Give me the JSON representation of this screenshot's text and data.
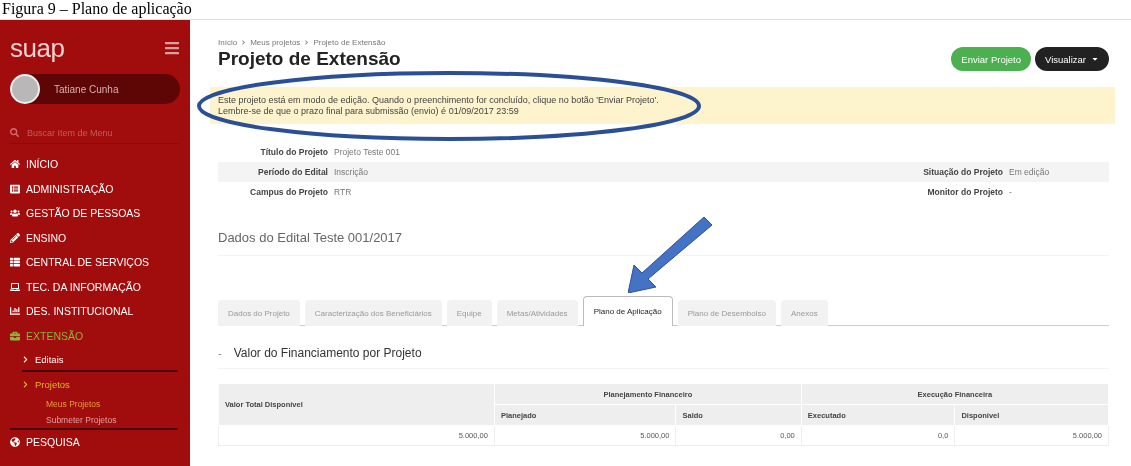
{
  "caption": "Figura 9 – Plano de aplicação",
  "sidebar": {
    "logo": "suap",
    "user_name": "Tatiane Cunha",
    "search": {
      "placeholder": "Buscar Item de Menu"
    },
    "menu": [
      {
        "label": "INÍCIO",
        "selected": false
      },
      {
        "label": "ADMINISTRAÇÃO",
        "selected": false
      },
      {
        "label": "GESTÃO DE PESSOAS",
        "selected": false
      },
      {
        "label": "ENSINO",
        "selected": false
      },
      {
        "label": "CENTRAL DE SERVIÇOS",
        "selected": false
      },
      {
        "label": "TEC. DA INFORMAÇÃO",
        "selected": false
      },
      {
        "label": "DES. INSTITUCIONAL",
        "selected": false
      },
      {
        "label": "EXTENSÃO",
        "selected": true,
        "children": [
          {
            "label": "Editais",
            "selected": false
          },
          {
            "label": "Projetos",
            "selected": true,
            "children": [
              {
                "label": "Meus Projetos",
                "selected": true
              },
              {
                "label": "Submeter Projetos",
                "selected": false
              }
            ]
          }
        ]
      },
      {
        "label": "PESQUISA",
        "selected": false
      }
    ]
  },
  "breadcrumbs": [
    "Início",
    "Meus projetos",
    "Projeto de Extensão"
  ],
  "title": "Projeto de Extensão",
  "buttons": [
    {
      "label": "Enviar Projeto",
      "kind": "primary"
    },
    {
      "label": "Visualizar",
      "kind": "dropdown"
    }
  ],
  "alert": [
    "Este projeto está em modo de edição. Quando o preenchimento for concluído, clique no botão 'Enviar Projeto'.",
    "Lembre-se de que o prazo final para submissão (envio) é 01/09/2017 23:59"
  ],
  "details": [
    {
      "left": {
        "label": "Título do Projeto",
        "value": "Projeto Teste 001"
      }
    },
    {
      "left": {
        "label": "Período do Edital",
        "value": "Inscrição"
      },
      "right": {
        "label": "Situação do Projeto",
        "value": "Em edição"
      }
    },
    {
      "left": {
        "label": "Campus do Projeto",
        "value": "RTR"
      },
      "right": {
        "label": "Monitor do Projeto",
        "value": "-"
      }
    }
  ],
  "section_title": "Dados do Edital Teste 001/2017",
  "tabs": [
    {
      "label": "Dados do Projeto",
      "selected": false
    },
    {
      "label": "Caracterização dos Beneficiários",
      "selected": false
    },
    {
      "label": "Equipe",
      "selected": false
    },
    {
      "label": "Metas/Atividades",
      "selected": false
    },
    {
      "label": "Plano de Aplicação",
      "selected": true
    },
    {
      "label": "Plano de Desembolso",
      "selected": false
    },
    {
      "label": "Anexos",
      "selected": false
    }
  ],
  "subsection": {
    "toggle": "-",
    "title": "Valor do Financiamento por Projeto",
    "expanded": true
  },
  "table": {
    "first_header": "Valor Total Disponível",
    "groups": [
      {
        "title": "Planejamento Financeiro",
        "columns": [
          "Planejado",
          "Saldo"
        ]
      },
      {
        "title": "Execução Financeira",
        "columns": [
          "Executado",
          "Disponível"
        ]
      }
    ],
    "rows": [
      [
        "5.000,00",
        "5.000,00",
        "0,00",
        "0,0",
        "5.000,00"
      ]
    ]
  }
}
